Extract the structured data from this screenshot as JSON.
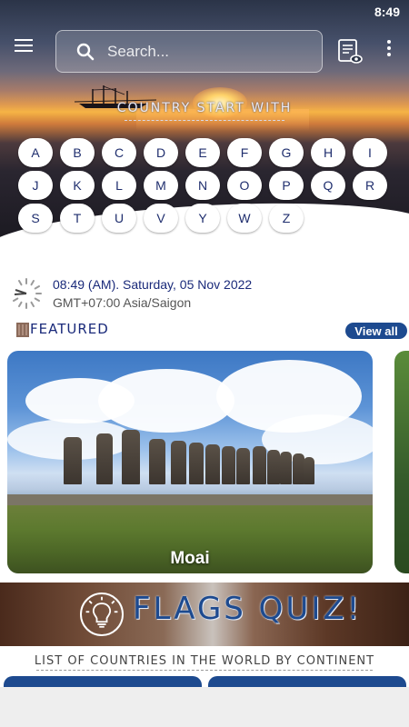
{
  "status_bar": {
    "time": "8:49"
  },
  "search": {
    "placeholder": "Search..."
  },
  "hero": {
    "title": "COUNTRY START WITH",
    "letters": [
      "A",
      "B",
      "C",
      "D",
      "E",
      "F",
      "G",
      "H",
      "I",
      "J",
      "K",
      "L",
      "M",
      "N",
      "O",
      "P",
      "Q",
      "R",
      "S",
      "T",
      "U",
      "V",
      "Y",
      "W",
      "Z"
    ]
  },
  "time_info": {
    "main": "08:49 (AM). Saturday, 05 Nov 2022",
    "zone": "GMT+07:00 Asia/Saigon"
  },
  "featured": {
    "label": "FEATURED",
    "view_all": "View all",
    "card_title": "Moai"
  },
  "quiz": {
    "label": "FLAGS QUIZ!"
  },
  "continents": {
    "title": "LIST OF COUNTRIES IN THE WORLD BY CONTINENT"
  },
  "colors": {
    "accent": "#1d4a8f",
    "text_blue": "#1a2a7a"
  },
  "icons": [
    "menu-icon",
    "search-icon",
    "list-view-icon",
    "more-vert-icon",
    "clock-icon",
    "featured-icon",
    "lightbulb-icon"
  ]
}
